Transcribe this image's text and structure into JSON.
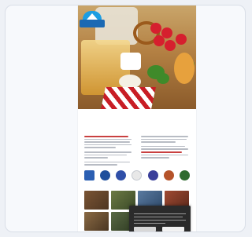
{
  "brand": {
    "logo_text": ""
  },
  "hero": {
    "headline_lines": [
      "",
      ""
    ],
    "colors": {
      "beer": "#e1b35a",
      "radish": "#d61f2e",
      "cloth": "#c81d25",
      "leaf": "#3f8a2a"
    }
  },
  "intro": {
    "eyebrow": "",
    "heading": ""
  },
  "badges": [
    {
      "name": "badge-1",
      "color": "#2b5fb3"
    },
    {
      "name": "badge-2",
      "color": "#1e4f9c"
    },
    {
      "name": "badge-3",
      "color": "#2f4fa8"
    },
    {
      "name": "badge-4",
      "color": "#e8e8e8"
    },
    {
      "name": "badge-5",
      "color": "#3a3f9a"
    },
    {
      "name": "badge-6",
      "color": "#b5532a"
    },
    {
      "name": "badge-7",
      "color": "#2f6b2f"
    }
  ],
  "photos": [
    {
      "color": "#6b4a2e"
    },
    {
      "color": "#5a6a3b"
    },
    {
      "color": "#3f5a7a"
    },
    {
      "color": "#8a3a2a"
    },
    {
      "color": "#7a5a3a"
    },
    {
      "color": "#4a5a3a"
    },
    {
      "color": "#6a4a3a"
    },
    {
      "color": "#3a3a3a"
    }
  ],
  "cookie_banner": {
    "title": "",
    "accept_label": "",
    "settings_label": ""
  }
}
